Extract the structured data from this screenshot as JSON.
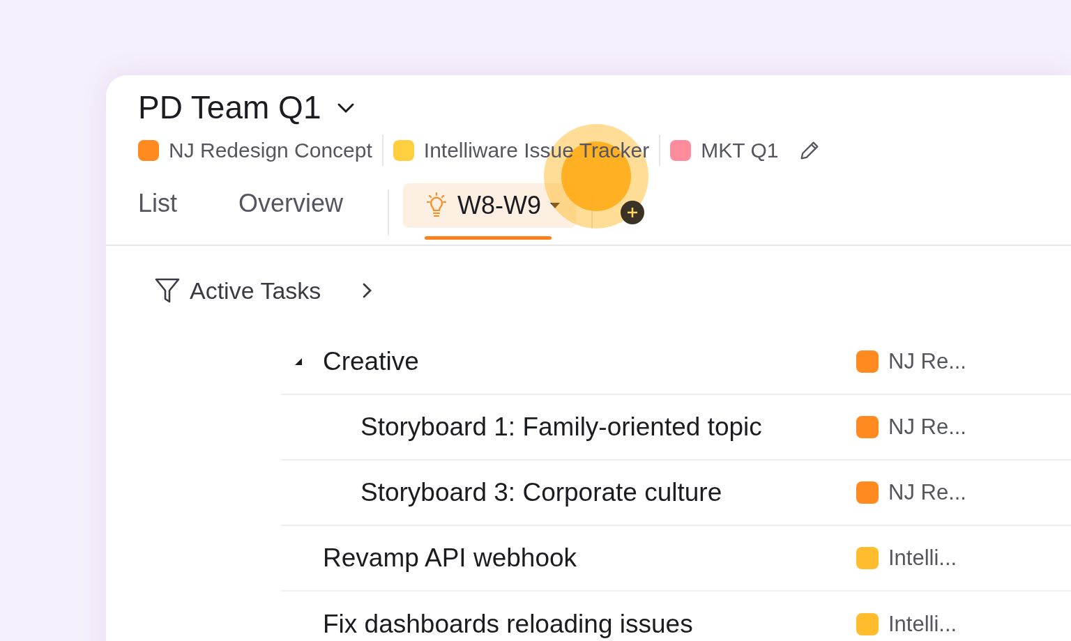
{
  "title": "PD Team Q1",
  "projects": [
    {
      "name": "NJ Redesign Concept",
      "color": "#ff8a1f"
    },
    {
      "name": "Intelliware Issue Tracker",
      "color": "#ffcf3f"
    },
    {
      "name": "MKT Q1",
      "color": "#ff8c9c"
    }
  ],
  "tabs": [
    {
      "label": "List",
      "selected": false,
      "kind": "plain"
    },
    {
      "label": "Overview",
      "selected": false,
      "kind": "plain"
    },
    {
      "label": "W8-W9",
      "selected": true,
      "kind": "custom"
    }
  ],
  "filter": {
    "label": "Active Tasks"
  },
  "tasks": [
    {
      "title": "Creative",
      "project": "NJ Re...",
      "color": "#ff8a1f",
      "expanded": true,
      "children": [
        {
          "title": "Storyboard 1: Family-oriented topic",
          "project": "NJ Re...",
          "color": "#ff8a1f"
        },
        {
          "title": "Storyboard 3: Corporate culture",
          "project": "NJ Re...",
          "color": "#ff8a1f"
        }
      ]
    },
    {
      "title": "Revamp API webhook",
      "project": "Intelli...",
      "color": "#ffbd2e"
    },
    {
      "title": "Fix dashboards reloading issues",
      "project": "Intelli...",
      "color": "#ffbd2e"
    }
  ]
}
